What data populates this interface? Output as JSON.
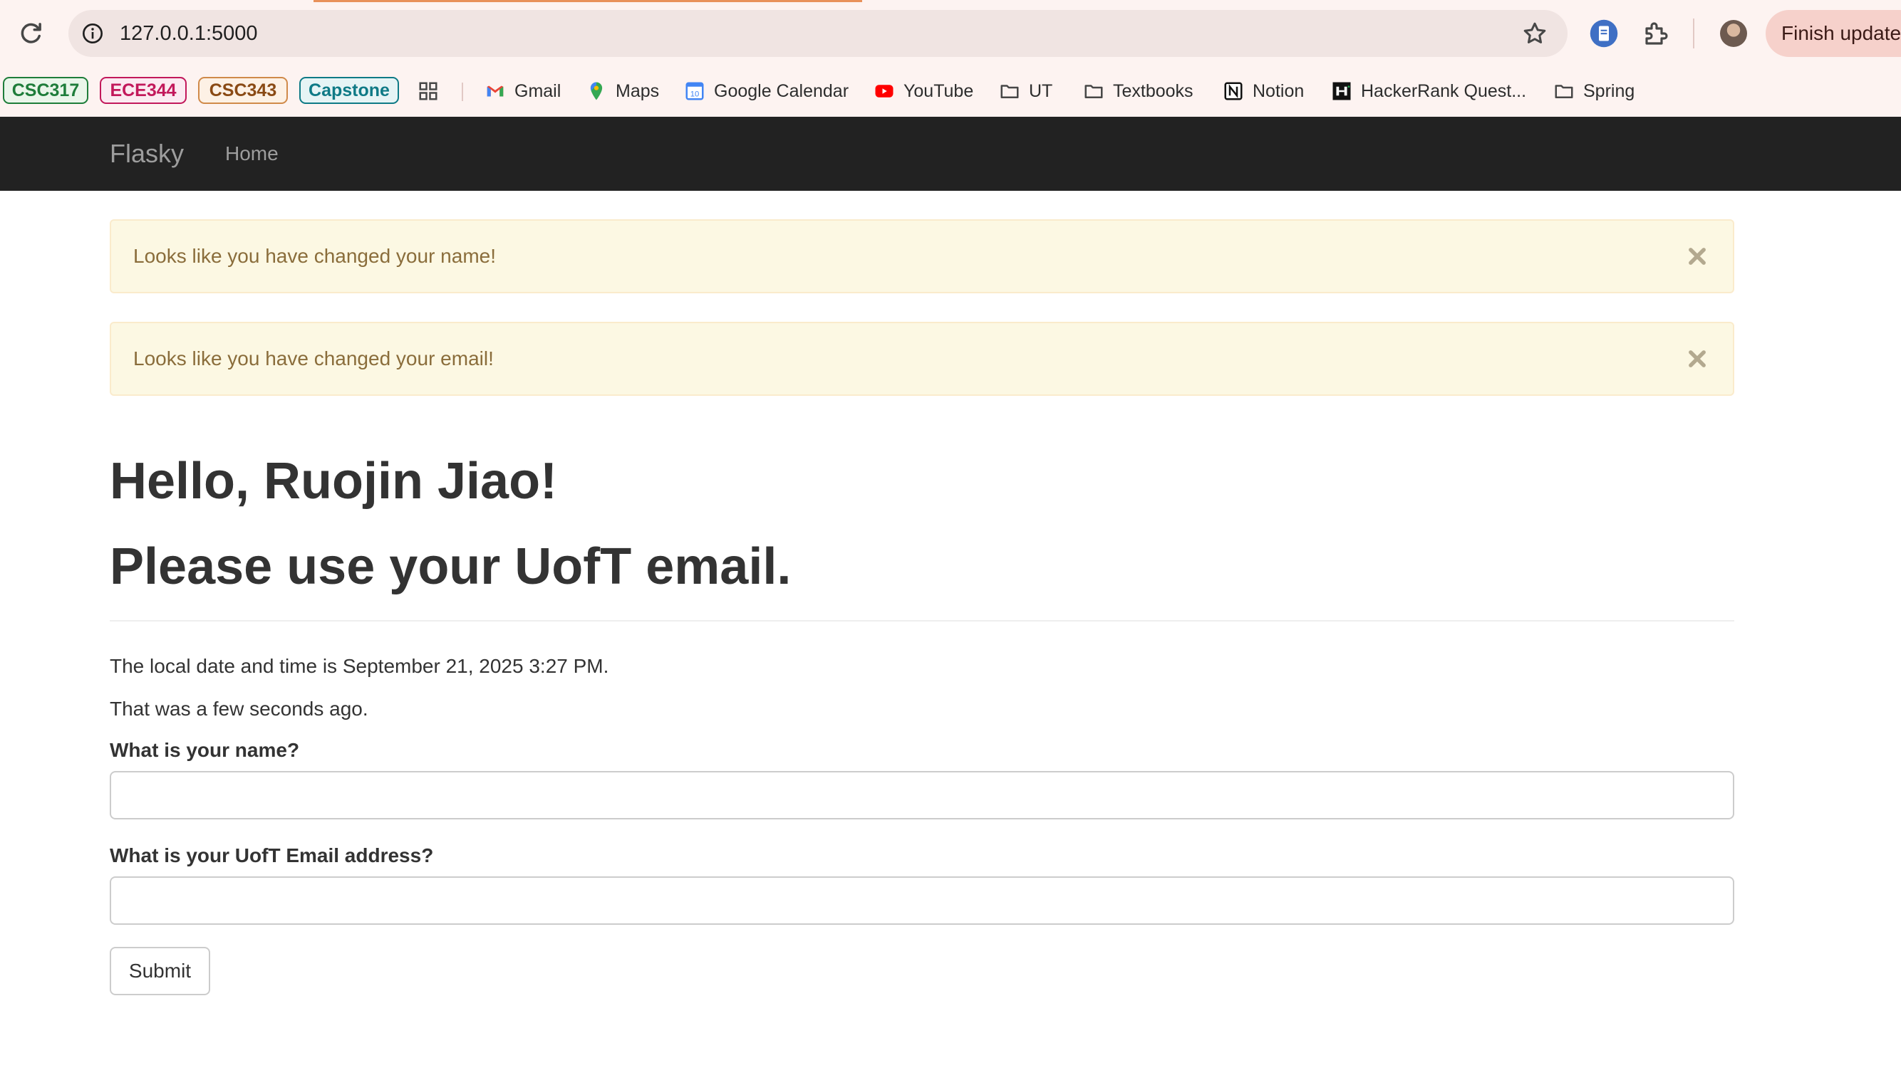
{
  "browser": {
    "url": "127.0.0.1:5000",
    "finish_update_label": "Finish update",
    "bookmarks_chips": [
      {
        "label": "CSC317",
        "color": "#1e7d3a"
      },
      {
        "label": "ECE344",
        "color": "#c2185b"
      },
      {
        "label": "CSC343",
        "color": "#b8621b"
      },
      {
        "label": "Capstone",
        "color": "#0f7a86"
      }
    ],
    "bookmarks": [
      {
        "label": "Gmail",
        "icon": "gmail-icon"
      },
      {
        "label": "Maps",
        "icon": "maps-pin-icon"
      },
      {
        "label": "Google Calendar",
        "icon": "calendar-icon"
      },
      {
        "label": "YouTube",
        "icon": "youtube-icon"
      },
      {
        "label": "UT",
        "icon": "folder-icon"
      },
      {
        "label": "Textbooks",
        "icon": "folder-icon"
      },
      {
        "label": "Notion",
        "icon": "notion-icon"
      },
      {
        "label": "HackerRank Quest...",
        "icon": "hackerrank-icon"
      },
      {
        "label": "Spring",
        "icon": "folder-icon"
      }
    ]
  },
  "navbar": {
    "brand": "Flasky",
    "home": "Home"
  },
  "alerts": [
    {
      "message": "Looks like you have changed your name!"
    },
    {
      "message": "Looks like you have changed your email!"
    }
  ],
  "page": {
    "greeting": "Hello, Ruojin Jiao!",
    "email_notice": "Please use your UofT email.",
    "local_time": "The local date and time is September 21, 2025 3:27 PM.",
    "relative_time": "That was a few seconds ago."
  },
  "form": {
    "name_label": "What is your name?",
    "name_value": "",
    "email_label": "What is your UofT Email address?",
    "email_value": "",
    "submit_label": "Submit"
  },
  "colors": {
    "navbar_bg": "#222222",
    "alert_bg": "#fcf8e3",
    "alert_text": "#8a6d3b"
  }
}
